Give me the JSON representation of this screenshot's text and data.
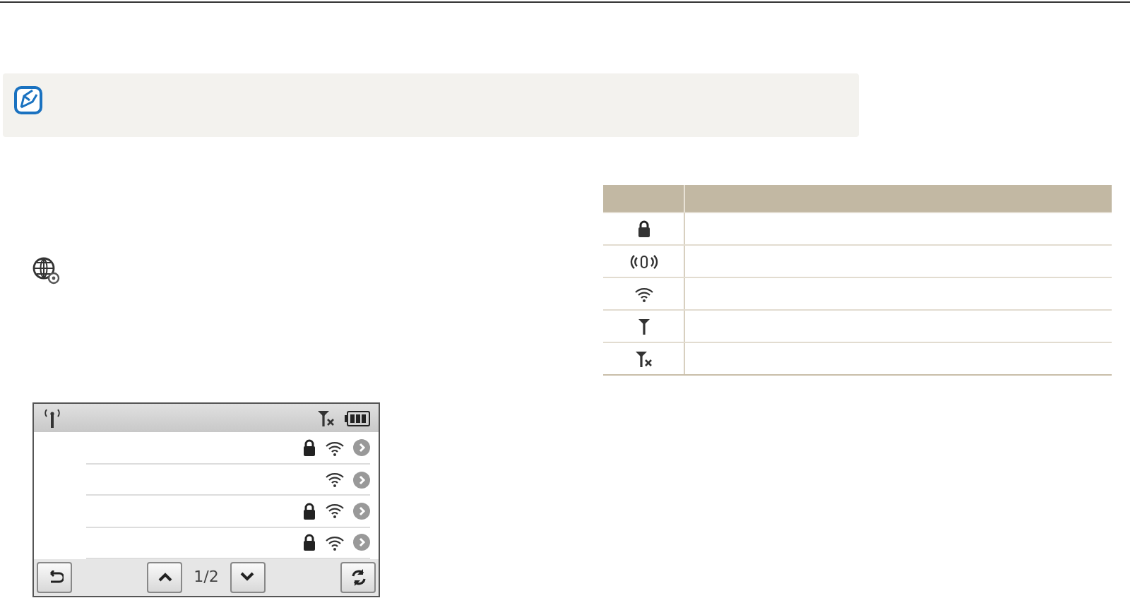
{
  "legend_table": {
    "rows": [
      {
        "kind": "lock"
      },
      {
        "kind": "access-point"
      },
      {
        "kind": "wifi"
      },
      {
        "kind": "antenna"
      },
      {
        "kind": "no-antenna"
      }
    ]
  },
  "camera_screen": {
    "networks": [
      {
        "locked": true
      },
      {
        "locked": false
      },
      {
        "locked": true
      },
      {
        "locked": true
      }
    ],
    "page": "1/2"
  }
}
